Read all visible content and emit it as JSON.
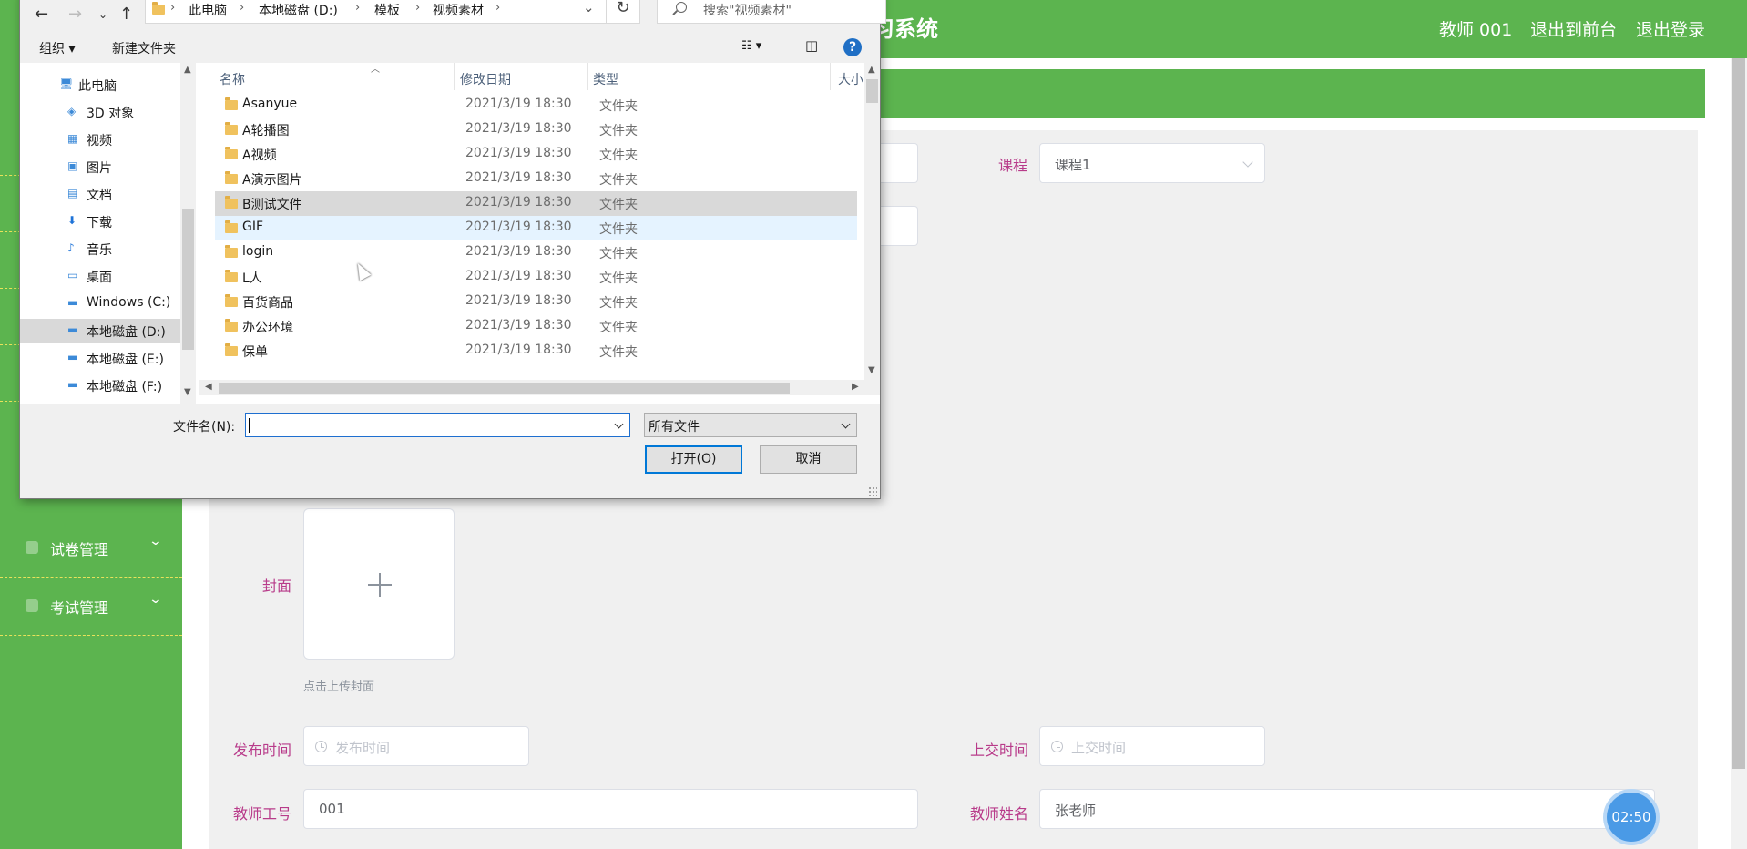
{
  "app": {
    "title_visible": "习系统",
    "user_link": "教师 001",
    "front_link": "退出到前台",
    "logout_link": "退出登录"
  },
  "sidebar": {
    "items": [
      {
        "label": "试卷管理",
        "icon": "doc-icon"
      },
      {
        "label": "考试管理",
        "icon": "doc-icon"
      }
    ]
  },
  "form": {
    "course_label": "课程",
    "course_value": "课程1",
    "cover_label": "封面",
    "cover_tip": "点击上传封面",
    "publish_label": "发布时间",
    "publish_placeholder": "发布时间",
    "submit_label": "上交时间",
    "submit_placeholder": "上交时间",
    "teacher_id_label": "教师工号",
    "teacher_id_value": "001",
    "teacher_name_label": "教师姓名",
    "teacher_name_value": "张老师"
  },
  "timer": "02:50",
  "dialog": {
    "breadcrumbs": [
      "此电脑",
      "本地磁盘 (D:)",
      "模板",
      "视频素材"
    ],
    "search_placeholder": "搜索\"视频素材\"",
    "organize": "组织 ▾",
    "new_folder": "新建文件夹",
    "help": "?",
    "tree": [
      {
        "label": "此电脑",
        "icon": "computer-icon",
        "selected": false
      },
      {
        "label": "3D 对象",
        "icon": "cube-icon",
        "selected": false
      },
      {
        "label": "视频",
        "icon": "video-icon",
        "selected": false
      },
      {
        "label": "图片",
        "icon": "picture-icon",
        "selected": false
      },
      {
        "label": "文档",
        "icon": "document-icon",
        "selected": false
      },
      {
        "label": "下载",
        "icon": "download-icon",
        "selected": false
      },
      {
        "label": "音乐",
        "icon": "music-icon",
        "selected": false
      },
      {
        "label": "桌面",
        "icon": "desktop-icon",
        "selected": false
      },
      {
        "label": "Windows (C:)",
        "icon": "drive-icon",
        "selected": false
      },
      {
        "label": "本地磁盘 (D:)",
        "icon": "drive-icon",
        "selected": true
      },
      {
        "label": "本地磁盘 (E:)",
        "icon": "drive-icon",
        "selected": false
      },
      {
        "label": "本地磁盘 (F:)",
        "icon": "drive-icon",
        "selected": false
      }
    ],
    "columns": {
      "name": "名称",
      "date": "修改日期",
      "type": "类型",
      "size": "大小"
    },
    "files": [
      {
        "name": "Asanyue",
        "date": "2021/3/19 18:30",
        "type": "文件夹",
        "state": ""
      },
      {
        "name": "A轮播图",
        "date": "2021/3/19 18:30",
        "type": "文件夹",
        "state": ""
      },
      {
        "name": "A视频",
        "date": "2021/3/19 18:30",
        "type": "文件夹",
        "state": ""
      },
      {
        "name": "A演示图片",
        "date": "2021/3/19 18:30",
        "type": "文件夹",
        "state": ""
      },
      {
        "name": "B测试文件",
        "date": "2021/3/19 18:30",
        "type": "文件夹",
        "state": "selected"
      },
      {
        "name": "GIF",
        "date": "2021/3/19 18:30",
        "type": "文件夹",
        "state": "hover"
      },
      {
        "name": "login",
        "date": "2021/3/19 18:30",
        "type": "文件夹",
        "state": ""
      },
      {
        "name": "L人",
        "date": "2021/3/19 18:30",
        "type": "文件夹",
        "state": ""
      },
      {
        "name": "百货商品",
        "date": "2021/3/19 18:30",
        "type": "文件夹",
        "state": ""
      },
      {
        "name": "办公环境",
        "date": "2021/3/19 18:30",
        "type": "文件夹",
        "state": ""
      },
      {
        "name": "保单",
        "date": "2021/3/19 18:30",
        "type": "文件夹",
        "state": ""
      }
    ],
    "filename_label": "文件名(N):",
    "filename_value": "",
    "filetype": "所有文件",
    "open_button": "打开(O)",
    "cancel_button": "取消"
  }
}
